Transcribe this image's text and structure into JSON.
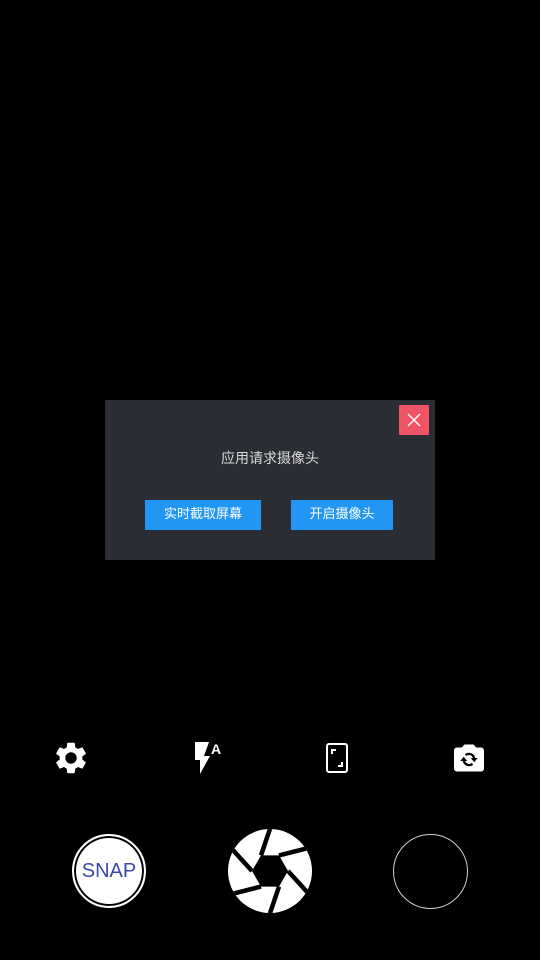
{
  "dialog": {
    "message": "应用请求摄像头",
    "screen_capture_button": "实时截取屏幕",
    "open_camera_button": "开启摄像头",
    "close_icon": "close-icon",
    "colors": {
      "background": "#2b2d34",
      "close": "#f05565",
      "button": "#2196f3"
    }
  },
  "controls": {
    "settings_icon": "gear-icon",
    "flash_icon": "flash-auto-icon",
    "flash_mode": "A",
    "aspect_icon": "aspect-ratio-icon",
    "switch_icon": "camera-switch-icon"
  },
  "bottom": {
    "snap_label": "SNAP",
    "shutter_icon": "aperture-icon",
    "snap_label_color": "#3949ab"
  }
}
